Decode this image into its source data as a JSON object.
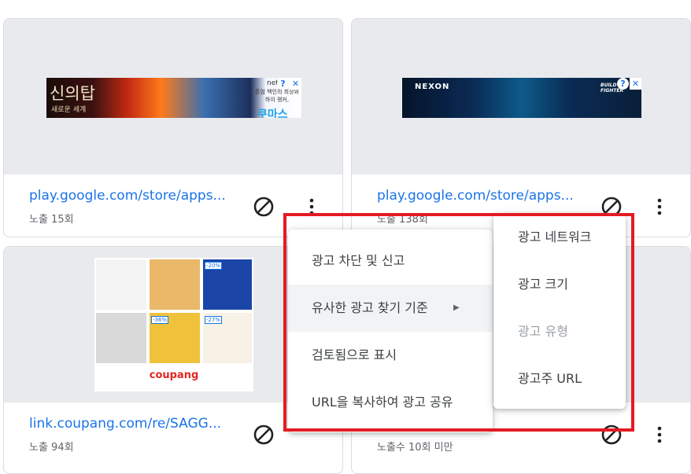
{
  "cards": [
    {
      "url": "play.google.com/store/apps...",
      "count": "노출 15회",
      "ad_text": "신의탑"
    },
    {
      "url": "play.google.com/store/apps...",
      "count": "노출 138회",
      "ad_text": "NEXON"
    },
    {
      "url": "link.coupang.com/re/SAGG...",
      "count": "노출 94회",
      "ad_text": "coupang"
    },
    {
      "url": "",
      "count": "노출수 10회 미만",
      "ad_text": ""
    }
  ],
  "ads": {
    "tower_subtitle": "새로운 세계",
    "tower_right_text": "존엄 백인의 최상위 하이 랭커,",
    "tower_bottom_text": "쿠마스 헤니",
    "tower_net": "net",
    "nexon_right": "BUILD FIGHTER",
    "coupang_badges": [
      "-20%",
      "-36%",
      "-27%"
    ]
  },
  "context_menu": {
    "items": [
      {
        "label": "광고 차단 및 신고"
      },
      {
        "label": "유사한 광고 찾기 기준",
        "submenu_arrow": "▶"
      },
      {
        "label": "검토됨으로 표시"
      },
      {
        "label": "URL을 복사하여 광고 공유"
      }
    ]
  },
  "sub_menu": {
    "items": [
      {
        "label": "광고 네트워크"
      },
      {
        "label": "광고 크기"
      },
      {
        "label": "광고 유형",
        "disabled": true
      },
      {
        "label": "광고주 URL"
      }
    ]
  },
  "adchoice_symbols": {
    "info": "?",
    "close": "✕"
  },
  "colors": {
    "accent": "#1a73e8",
    "highlight_box": "#e31b23",
    "preview_bg": "#e8eaed"
  }
}
